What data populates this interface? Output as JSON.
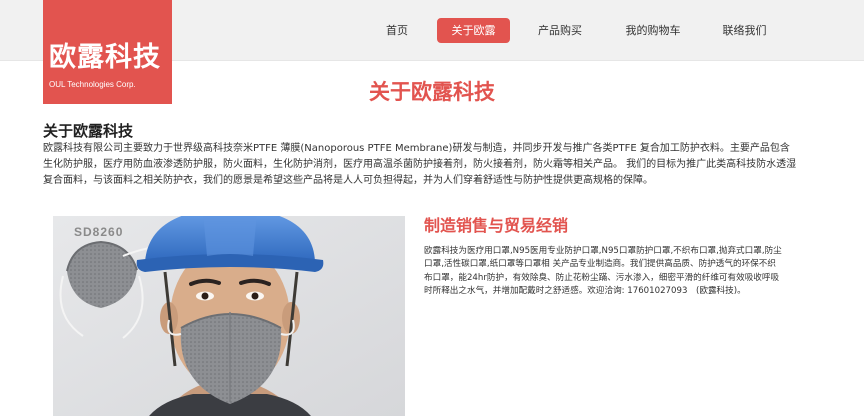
{
  "logo": {
    "name": "欧露科技",
    "sub": "OUL Technologies Corp."
  },
  "nav": {
    "items": [
      {
        "label": "首页",
        "active": false
      },
      {
        "label": "关于欧露",
        "active": true
      },
      {
        "label": "产品购买",
        "active": false
      },
      {
        "label": "我的购物车",
        "active": false
      },
      {
        "label": "联络我们",
        "active": false
      }
    ]
  },
  "page": {
    "title": "关于欧露科技"
  },
  "about": {
    "title": "关于欧露科技",
    "text": "欧露科技有限公司主要致力于世界级高科技奈米PTFE 薄膜(Nanoporous PTFE Membrane)研发与制造，并同步开发与推广各类PTFE 复合加工防护衣料。主要产品包含生化防护服，医疗用防血液渗透防护服，防火面料，生化防护消剂，医疗用高温杀菌防护接着剂，防火接着剂，防火霜等相关产品。 我们的目标为推广此类高科技防水透湿复合面料，与该面料之相关防护衣，我们的愿景是希望这些产品将是人人可负担得起，并为人们穿着舒适性与防护性提供更高规格的保障。"
  },
  "product_photo": {
    "model_label": "SD8260"
  },
  "sales": {
    "title": "制造销售与贸易经销",
    "text": "欧露科技为医疗用口罩,N95医用专业防护口罩,N95口罩防护口罩,不织布口罩,抛弃式口罩,防尘口罩,活性碳口罩,纸口罩等口罩相 关产品专业制造商。我们提供高品质、防护透气的环保不织布口罩，能24hr防护，有效除臭、防止花粉尘蹣、污水渗入，细密平滑的纤维可有效吸收呼吸时所释出之水气，并增加配戴时之舒适感。欢迎洽询: 17601027093　(欧露科技)。"
  },
  "colors": {
    "accent": "#e2544f",
    "header_bg": "#f1f1f1",
    "helmet": "#3f7fd1"
  }
}
